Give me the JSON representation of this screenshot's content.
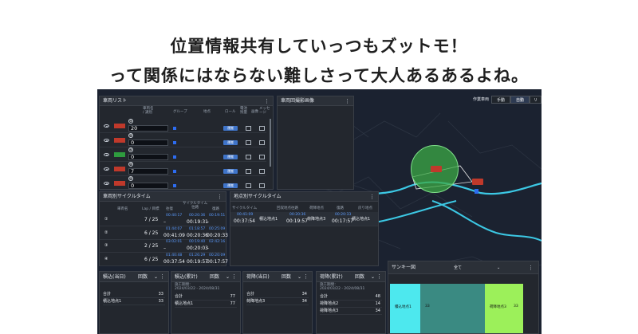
{
  "headline": {
    "line1": "位置情報共有していっつもズットモ！",
    "line2": "って関係にはならない難しさって大人あるあるよね。"
  },
  "map_controls": {
    "label": "作業車両",
    "btn_manual": "手動",
    "btn_auto": "自動",
    "btn_extra": "リ"
  },
  "vehicle_list": {
    "title": "車両リスト",
    "headers": {
      "vehicle": "車両名\n/ 識別",
      "group": "グループ",
      "location": "地点",
      "role": "ロール",
      "status": "電池\n残量",
      "image": "画像",
      "message": "メッセージ"
    },
    "rows": [
      {
        "num": "①",
        "value": "20",
        "tag": "運搬"
      },
      {
        "num": "②",
        "value": "0",
        "tag": "運搬"
      },
      {
        "num": "③",
        "value": "0",
        "tag": "運搬"
      },
      {
        "num": "④",
        "value": "7",
        "tag": "運搬"
      },
      {
        "num": "⑤",
        "value": "0",
        "tag": "運搬"
      }
    ]
  },
  "image_panel": {
    "title": "車両回撮影画像"
  },
  "vehicle_cycle": {
    "title": "車両別サイクルタイム",
    "headers": [
      "車両名",
      "Lap / 目標",
      "往復",
      "サイクルタイム\n往路",
      "復路"
    ],
    "rows": [
      {
        "num": "①",
        "lap": "7 / 25",
        "a_top": "00:40:17",
        "a_bot": "–",
        "b_top": "00:20:36",
        "b_bot": "00:19:31",
        "c_top": "00:19:51",
        "c_bot": "–"
      },
      {
        "num": "②",
        "lap": "6 / 25",
        "a_top": "01:44:07",
        "a_bot": "00:41:09",
        "b_top": "01:18:57",
        "b_bot": "00:20:36",
        "c_top": "00:25:09",
        "c_bot": "00:20:33"
      },
      {
        "num": "③",
        "lap": "2 / 25",
        "a_top": "03:02:01",
        "a_bot": "–",
        "b_top": "00:19:40",
        "b_bot": "00:20:03",
        "c_top": "02:42:16",
        "c_bot": "–"
      },
      {
        "num": "④",
        "lap": "6 / 25",
        "a_top": "01:40:48",
        "a_bot": "00:37:54",
        "b_top": "01:26:29",
        "b_bot": "00:19:57",
        "c_top": "00:20:09",
        "c_bot": "00:17:57"
      }
    ]
  },
  "point_cycle": {
    "title": "地点別サイクルタイム",
    "headers": [
      "サイクルタイム",
      "回収地点",
      "往路",
      "荷降地点",
      "復路",
      "戻り地点"
    ],
    "row": {
      "t_top": "00:41:09",
      "t_bot": "00:37:54",
      "p1": "積込地点1",
      "go_top": "00:20:36",
      "go_bot": "00:19:57",
      "p2": "荷降地点3",
      "back_top": "00:20:33",
      "back_bot": "00:17:57",
      "p3": "積込地点1"
    }
  },
  "bottom_panels": [
    {
      "title": "積込(当日)",
      "unit": "回数",
      "period": "",
      "rows": [
        {
          "label": "合計",
          "value": "33"
        },
        {
          "label": "積込地点1",
          "value": "33"
        }
      ]
    },
    {
      "title": "積込(累計)",
      "unit": "回数",
      "period": "施工期間：\n2024/03/22 - 2024/08/31",
      "rows": [
        {
          "label": "合計",
          "value": "77"
        },
        {
          "label": "積込地点1",
          "value": "77"
        }
      ]
    },
    {
      "title": "荷降(当日)",
      "unit": "回数",
      "period": "",
      "rows": [
        {
          "label": "合計",
          "value": "34"
        },
        {
          "label": "荷降地点3",
          "value": "34"
        }
      ]
    },
    {
      "title": "荷降(累計)",
      "unit": "回数",
      "period": "施工期間：\n2024/03/22 - 2024/08/31",
      "rows": [
        {
          "label": "合計",
          "value": "48"
        },
        {
          "label": "荷降地点2",
          "value": "14"
        },
        {
          "label": "荷降地点3",
          "value": "34"
        }
      ]
    }
  ],
  "sankey": {
    "title": "サンキー図",
    "filter": "全て",
    "left_label": "積込地点1",
    "left_value": "33",
    "mid_value": "33",
    "right_label": "荷降地点3",
    "right_value": "33",
    "colors": {
      "left": "#4de8ee",
      "mid": "#3a8a82",
      "right": "#9cf05a"
    }
  }
}
